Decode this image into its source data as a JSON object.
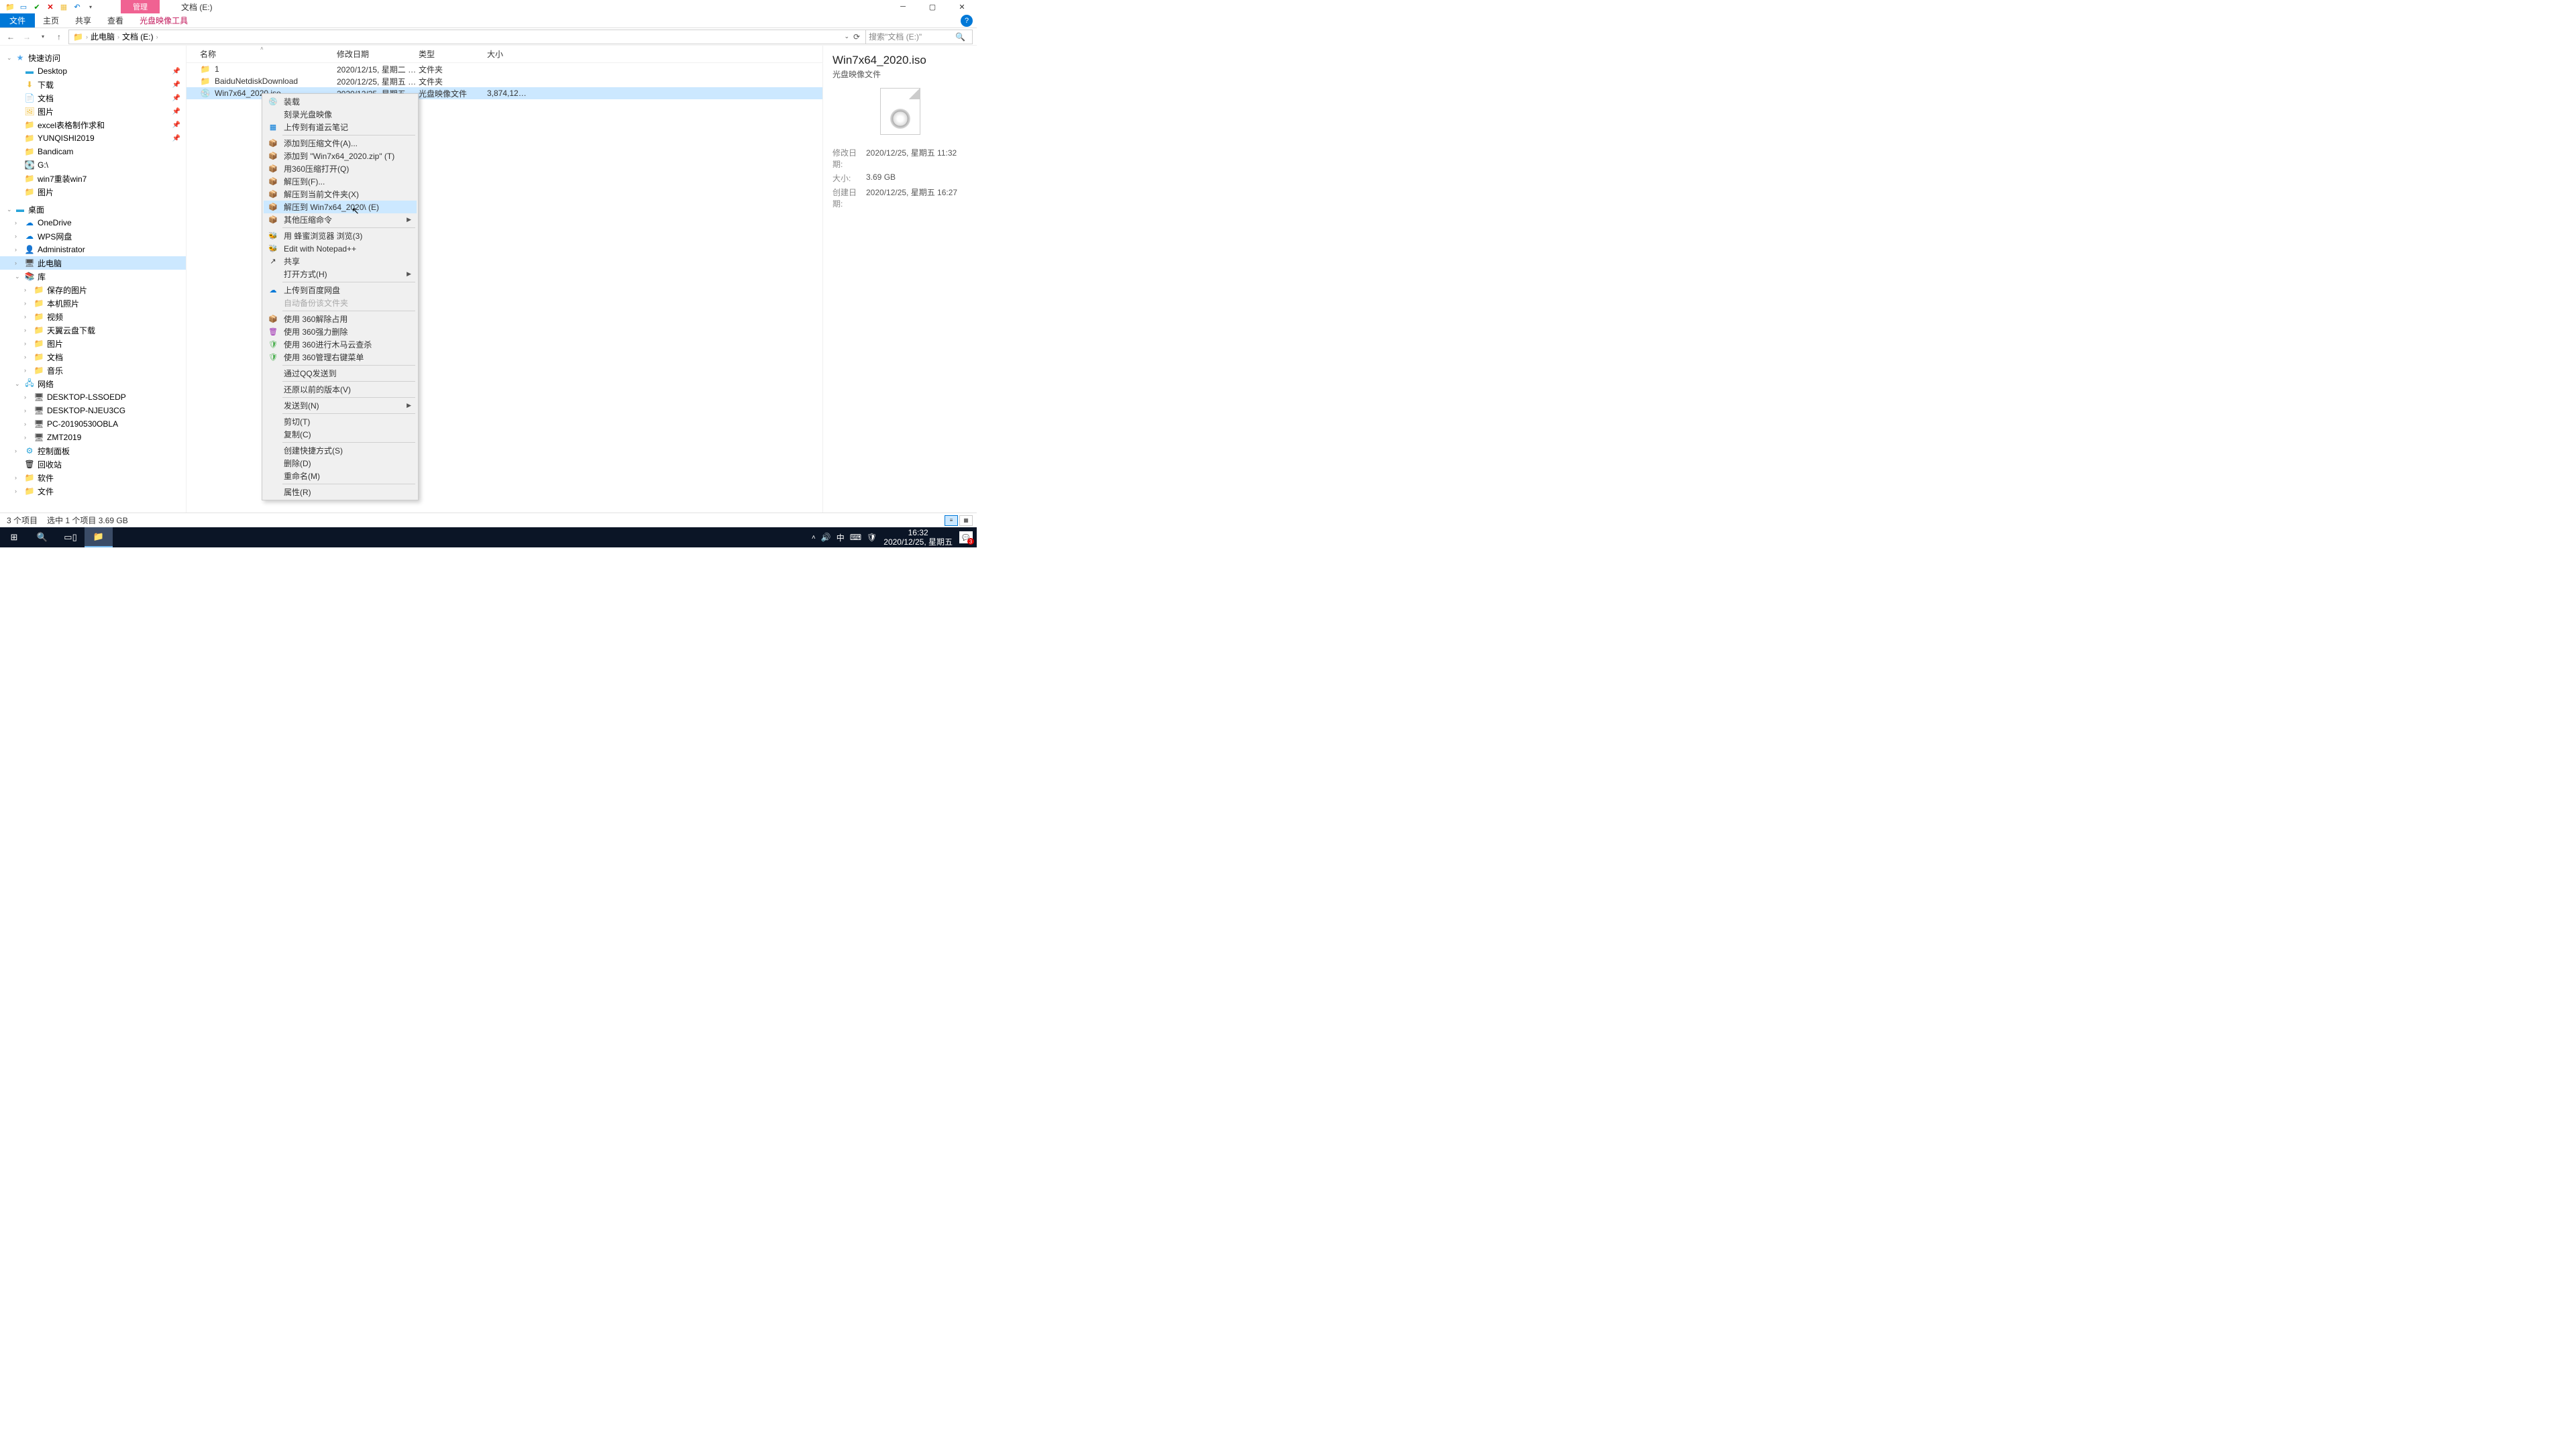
{
  "title_context": "管理",
  "window_title": "文档 (E:)",
  "ribbon": {
    "file": "文件",
    "home": "主页",
    "share": "共享",
    "view": "查看",
    "tool": "光盘映像工具"
  },
  "path": {
    "root": "此电脑",
    "current": "文档 (E:)"
  },
  "search_placeholder": "搜索\"文档 (E:)\"",
  "columns": {
    "name": "名称",
    "modified": "修改日期",
    "type": "类型",
    "size": "大小"
  },
  "rows": [
    {
      "name": "1",
      "modified": "2020/12/15, 星期二 1...",
      "type": "文件夹",
      "size": ""
    },
    {
      "name": "BaiduNetdiskDownload",
      "modified": "2020/12/25, 星期五 1...",
      "type": "文件夹",
      "size": ""
    },
    {
      "name": "Win7x64_2020.iso",
      "modified": "2020/12/25, 星期五 1...",
      "type": "光盘映像文件",
      "size": "3,874,126..."
    }
  ],
  "nav": {
    "quick": "快速访问",
    "quick_items": [
      "Desktop",
      "下载",
      "文档",
      "图片",
      "excel表格制作求和",
      "YUNQISHI2019",
      "Bandicam",
      "G:\\",
      "win7重装win7",
      "图片"
    ],
    "desktop": "桌面",
    "desktop_items": [
      "OneDrive",
      "WPS网盘",
      "Administrator",
      "此电脑",
      "库",
      "保存的图片",
      "本机照片",
      "视频",
      "天翼云盘下载",
      "图片",
      "文档",
      "音乐",
      "网络",
      "DESKTOP-LSSOEDP",
      "DESKTOP-NJEU3CG",
      "PC-20190530OBLA",
      "ZMT2019",
      "控制面板",
      "回收站",
      "软件",
      "文件"
    ]
  },
  "details": {
    "title": "Win7x64_2020.iso",
    "subtitle": "光盘映像文件",
    "kv": [
      {
        "k": "修改日期:",
        "v": "2020/12/25, 星期五 11:32"
      },
      {
        "k": "大小:",
        "v": "3.69 GB"
      },
      {
        "k": "创建日期:",
        "v": "2020/12/25, 星期五 16:27"
      }
    ]
  },
  "status": {
    "count": "3 个项目",
    "selected": "选中 1 个项目  3.69 GB"
  },
  "ctx": [
    {
      "label": "装载",
      "icon": "disc"
    },
    {
      "label": "刻录光盘映像"
    },
    {
      "label": "上传到有道云笔记",
      "icon": "blue"
    },
    {
      "sep": true
    },
    {
      "label": "添加到压缩文件(A)...",
      "icon": "yellow"
    },
    {
      "label": "添加到 \"Win7x64_2020.zip\" (T)",
      "icon": "yellow"
    },
    {
      "label": "用360压缩打开(Q)",
      "icon": "yellow"
    },
    {
      "label": "解压到(F)...",
      "icon": "yellow"
    },
    {
      "label": "解压到当前文件夹(X)",
      "icon": "yellow"
    },
    {
      "label": "解压到 Win7x64_2020\\ (E)",
      "icon": "yellow",
      "hover": true
    },
    {
      "label": "其他压缩命令",
      "icon": "yellow",
      "arrow": true
    },
    {
      "sep": true
    },
    {
      "label": "用 蜂蜜浏览器 浏览(3)",
      "icon": "green"
    },
    {
      "label": "Edit with Notepad++",
      "icon": "green"
    },
    {
      "label": "共享",
      "icon": "share"
    },
    {
      "label": "打开方式(H)",
      "arrow": true
    },
    {
      "sep": true
    },
    {
      "label": "上传到百度网盘",
      "icon": "blue2"
    },
    {
      "label": "自动备份该文件夹",
      "disabled": true
    },
    {
      "sep": true
    },
    {
      "label": "使用 360解除占用",
      "icon": "yellow"
    },
    {
      "label": "使用 360强力删除",
      "icon": "purple"
    },
    {
      "label": "使用 360进行木马云查杀",
      "icon": "green2"
    },
    {
      "label": "使用 360管理右键菜单",
      "icon": "green2"
    },
    {
      "sep": true
    },
    {
      "label": "通过QQ发送到"
    },
    {
      "sep": true
    },
    {
      "label": "还原以前的版本(V)"
    },
    {
      "sep": true
    },
    {
      "label": "发送到(N)",
      "arrow": true
    },
    {
      "sep": true
    },
    {
      "label": "剪切(T)"
    },
    {
      "label": "复制(C)"
    },
    {
      "sep": true
    },
    {
      "label": "创建快捷方式(S)"
    },
    {
      "label": "删除(D)"
    },
    {
      "label": "重命名(M)"
    },
    {
      "sep": true
    },
    {
      "label": "属性(R)"
    }
  ],
  "taskbar": {
    "time": "16:32",
    "date": "2020/12/25, 星期五",
    "ime": "中",
    "notif_count": "3"
  }
}
